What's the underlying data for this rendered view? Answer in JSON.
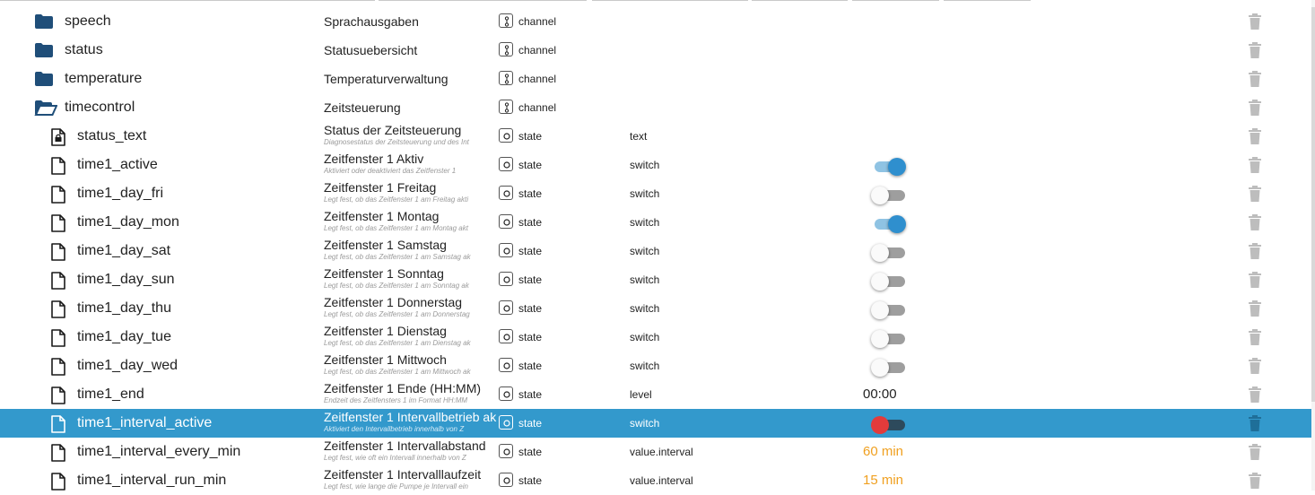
{
  "rows": [
    {
      "id": "speech",
      "name": "speech",
      "kind": "folder",
      "title": "Sprachausgaben",
      "desc": "",
      "type": "channel",
      "role": "",
      "value": ""
    },
    {
      "id": "status",
      "name": "status",
      "kind": "folder",
      "title": "Statusuebersicht",
      "desc": "",
      "type": "channel",
      "role": "",
      "value": ""
    },
    {
      "id": "temperature",
      "name": "temperature",
      "kind": "folder",
      "title": "Temperaturverwaltung",
      "desc": "",
      "type": "channel",
      "role": "",
      "value": ""
    },
    {
      "id": "timecontrol",
      "name": "timecontrol",
      "kind": "folder-open",
      "title": "Zeitsteuerung",
      "desc": "",
      "type": "channel",
      "role": "",
      "value": ""
    },
    {
      "id": "status_text",
      "name": "status_text",
      "kind": "file-locked",
      "title": "Status der Zeitsteuerung",
      "desc": "Diagnosestatus der Zeitsteuerung und des Int",
      "type": "state",
      "role": "text",
      "value": ""
    },
    {
      "id": "time1_active",
      "name": "time1_active",
      "kind": "file",
      "title": "Zeitfenster 1 Aktiv",
      "desc": "Aktiviert oder deaktiviert das Zeitfenster 1",
      "type": "state",
      "role": "switch",
      "toggle": "on"
    },
    {
      "id": "time1_day_fri",
      "name": "time1_day_fri",
      "kind": "file",
      "title": "Zeitfenster 1 Freitag",
      "desc": "Legt fest, ob das Zeitfenster 1 am Freitag akti",
      "type": "state",
      "role": "switch",
      "toggle": "off"
    },
    {
      "id": "time1_day_mon",
      "name": "time1_day_mon",
      "kind": "file",
      "title": "Zeitfenster 1 Montag",
      "desc": "Legt fest, ob das Zeitfenster 1 am Montag akt",
      "type": "state",
      "role": "switch",
      "toggle": "on"
    },
    {
      "id": "time1_day_sat",
      "name": "time1_day_sat",
      "kind": "file",
      "title": "Zeitfenster 1 Samstag",
      "desc": "Legt fest, ob das Zeitfenster 1 am Samstag ak",
      "type": "state",
      "role": "switch",
      "toggle": "off"
    },
    {
      "id": "time1_day_sun",
      "name": "time1_day_sun",
      "kind": "file",
      "title": "Zeitfenster 1 Sonntag",
      "desc": "Legt fest, ob das Zeitfenster 1 am Sonntag ak",
      "type": "state",
      "role": "switch",
      "toggle": "off"
    },
    {
      "id": "time1_day_thu",
      "name": "time1_day_thu",
      "kind": "file",
      "title": "Zeitfenster 1 Donnerstag",
      "desc": "Legt fest, ob das Zeitfenster 1 am Donnerstag",
      "type": "state",
      "role": "switch",
      "toggle": "off"
    },
    {
      "id": "time1_day_tue",
      "name": "time1_day_tue",
      "kind": "file",
      "title": "Zeitfenster 1 Dienstag",
      "desc": "Legt fest, ob das Zeitfenster 1 am Dienstag ak",
      "type": "state",
      "role": "switch",
      "toggle": "off"
    },
    {
      "id": "time1_day_wed",
      "name": "time1_day_wed",
      "kind": "file",
      "title": "Zeitfenster 1 Mittwoch",
      "desc": "Legt fest, ob das Zeitfenster 1 am Mittwoch ak",
      "type": "state",
      "role": "switch",
      "toggle": "off"
    },
    {
      "id": "time1_end",
      "name": "time1_end",
      "kind": "file",
      "title": "Zeitfenster 1 Ende (HH:MM)",
      "desc": "Endzeit des Zeitfensters 1 im Format HH:MM",
      "type": "state",
      "role": "level",
      "value": "00:00",
      "valueStyle": "plain"
    },
    {
      "id": "time1_interval_active",
      "name": "time1_interval_active",
      "kind": "file",
      "title": "Zeitfenster 1 Intervallbetrieb ak",
      "desc": "Aktiviert den Intervallbetrieb innerhalb von Z",
      "type": "state",
      "role": "switch",
      "toggle": "red",
      "selected": true
    },
    {
      "id": "time1_interval_every_min",
      "name": "time1_interval_every_min",
      "kind": "file",
      "title": "Zeitfenster 1 Intervallabstand",
      "desc": "Legt fest, wie oft ein Intervall innerhalb von Z",
      "type": "state",
      "role": "value.interval",
      "value": "60 min",
      "valueStyle": "num"
    },
    {
      "id": "time1_interval_run_min",
      "name": "time1_interval_run_min",
      "kind": "file",
      "title": "Zeitfenster 1 Intervalllaufzeit",
      "desc": "Legt fest, wie lange die Pumpe je Intervall ein",
      "type": "state",
      "role": "value.interval",
      "value": "15 min",
      "valueStyle": "num"
    }
  ],
  "colors": {
    "selected_row": "#3399cc",
    "folder": "#1f4e79",
    "toggle_on": "#2f8fce",
    "toggle_alert": "#e33b3b",
    "number_value": "#f0a020",
    "trash": "#bdbdbd"
  },
  "icons": {
    "folder": "folder-icon",
    "folder-open": "folder-open-icon",
    "file": "file-icon",
    "file-locked": "file-lock-icon",
    "channel": "channel-type-icon",
    "state": "state-type-icon",
    "delete": "trash-icon"
  }
}
